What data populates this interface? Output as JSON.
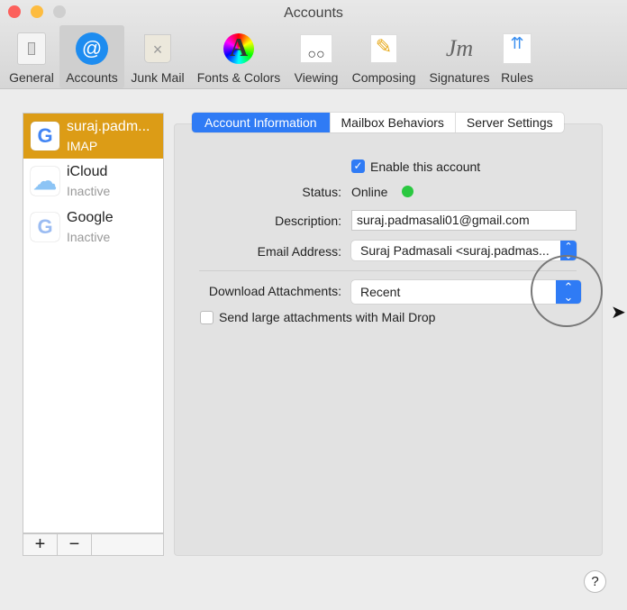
{
  "window": {
    "title": "Accounts"
  },
  "toolbar": [
    {
      "label": "General",
      "icon": "switch-icon"
    },
    {
      "label": "Accounts",
      "icon": "at-icon"
    },
    {
      "label": "Junk Mail",
      "icon": "trash-icon"
    },
    {
      "label": "Fonts & Colors",
      "icon": "color-wheel-icon"
    },
    {
      "label": "Viewing",
      "icon": "glasses-icon"
    },
    {
      "label": "Composing",
      "icon": "pencil-icon"
    },
    {
      "label": "Signatures",
      "icon": "signature-icon"
    },
    {
      "label": "Rules",
      "icon": "rules-icon"
    }
  ],
  "accounts": [
    {
      "name": "suraj.padm...",
      "status": "IMAP",
      "logo": "G"
    },
    {
      "name": "iCloud",
      "status": "Inactive",
      "logo": "☁"
    },
    {
      "name": "Google",
      "status": "Inactive",
      "logo": "G"
    }
  ],
  "sidebar_buttons": {
    "add": "+",
    "remove": "−"
  },
  "tabs": [
    "Account Information",
    "Mailbox Behaviors",
    "Server Settings"
  ],
  "form": {
    "enable_label": "Enable this account",
    "status_label": "Status:",
    "status_value": "Online",
    "description_label": "Description:",
    "description_value": "suraj.padmasali01@gmail.com",
    "email_label": "Email Address:",
    "email_value": "Suraj Padmasali <suraj.padmas...",
    "download_label": "Download Attachments:",
    "download_value": "Recent",
    "maildrop_label": "Send large attachments with Mail Drop"
  },
  "help": "?",
  "colors": {
    "accent": "#2f7bf5",
    "selected_account": "#dc9c16",
    "online": "#2ac840"
  }
}
